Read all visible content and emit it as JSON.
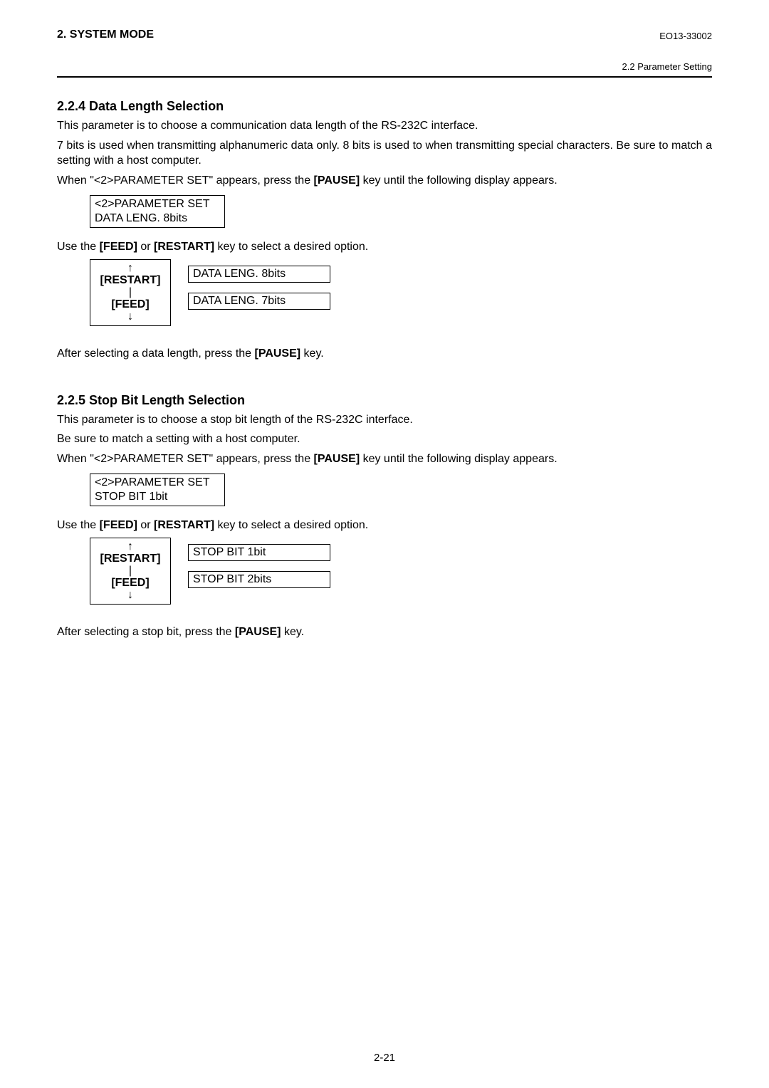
{
  "header": {
    "left": "2. SYSTEM MODE",
    "right": "EO13-33002",
    "sub": "2.2 Parameter Setting"
  },
  "sec224": {
    "title": "2.2.4  Data Length Selection",
    "p1": "This parameter is to choose a communication data length of the RS-232C interface.",
    "p2a": "7 bits is used when transmitting alphanumeric data only.  8 bits is used to when transmitting special characters.  Be sure to match a setting with a host computer.",
    "p3a": "When \"<2>PARAMETER SET\" appears, press the ",
    "p3key": "[PAUSE]",
    "p3b": " key until the following display appears.",
    "lcd": {
      "l1": "<2>PARAMETER SET",
      "l2": "DATA LENG. 8bits"
    },
    "use_a": "Use the ",
    "use_k1": "[FEED]",
    "use_mid": " or ",
    "use_k2": "[RESTART]",
    "use_b": " key to select a desired option.",
    "btn_restart": "[RESTART]",
    "btn_feed": "[FEED]",
    "opt1": "DATA LENG. 8bits",
    "opt2": "DATA LENG. 7bits",
    "tail_a": "After selecting a data length, press the ",
    "tail_key": "[PAUSE]",
    "tail_b": " key."
  },
  "sec225": {
    "title": "2.2.5  Stop Bit Length Selection",
    "p1": "This parameter is to choose a stop bit length of the RS-232C interface.",
    "p2": "Be sure to match a setting with a host computer.",
    "p3a": "When \"<2>PARAMETER SET\" appears, press the ",
    "p3key": "[PAUSE]",
    "p3b": " key until the following display appears.",
    "lcd": {
      "l1": "<2>PARAMETER SET",
      "l2": "STOP BIT  1bit"
    },
    "use_a": "Use the ",
    "use_k1": "[FEED]",
    "use_mid": " or ",
    "use_k2": "[RESTART]",
    "use_b": " key to select a desired option.",
    "btn_restart": "[RESTART]",
    "btn_feed": "[FEED]",
    "opt1": "STOP BIT  1bit",
    "opt2": "STOP BIT  2bits",
    "tail_a": "After selecting a stop bit, press the ",
    "tail_key": "[PAUSE]",
    "tail_b": " key."
  },
  "page_number": "2-21",
  "arrows": {
    "up": "↑",
    "down": "↓",
    "divider": "|"
  }
}
